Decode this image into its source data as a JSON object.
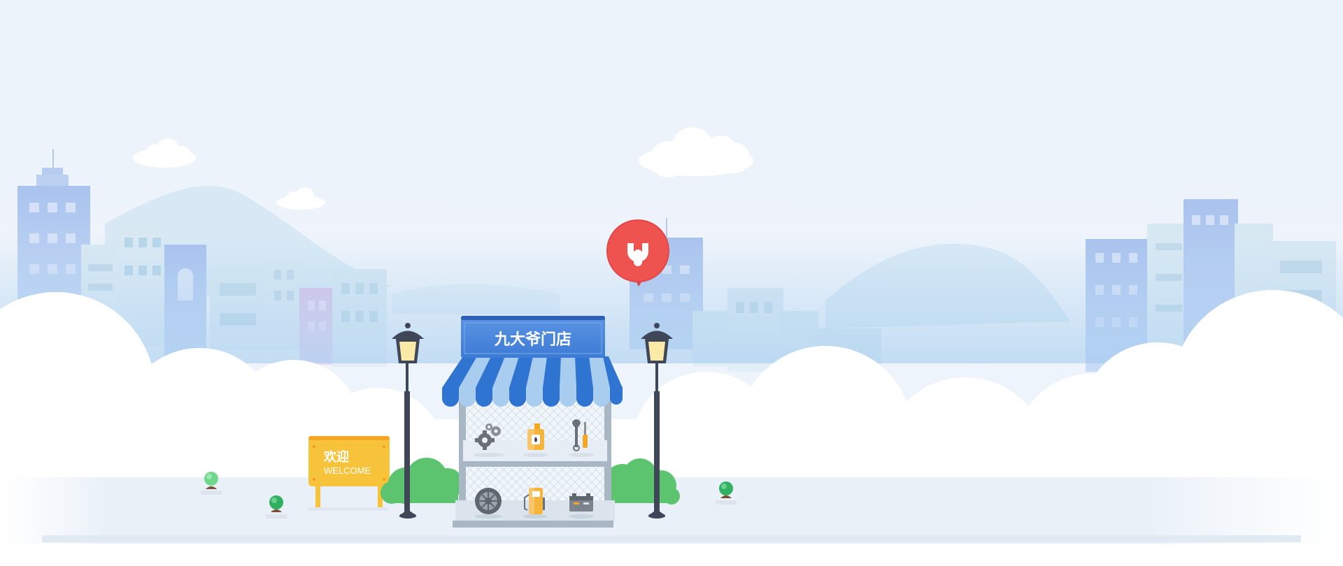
{
  "store": {
    "name": "九大爷门店"
  },
  "welcome_sign": {
    "title": "欢迎",
    "subtitle": "WELCOME"
  },
  "colors": {
    "sky": "#eef4fb",
    "awning_blue": "#2f74d0",
    "awning_light": "#a9cdef",
    "sign_yellow": "#f7c33b",
    "pin_red": "#ef5350",
    "bush_green": "#5cc46e",
    "lamp_dark": "#3e4658"
  },
  "icons": [
    "gears-icon",
    "oil-can-icon",
    "wrench-screwdriver-icon",
    "tire-icon",
    "fuel-pump-icon",
    "battery-icon",
    "service-pin-icon"
  ]
}
